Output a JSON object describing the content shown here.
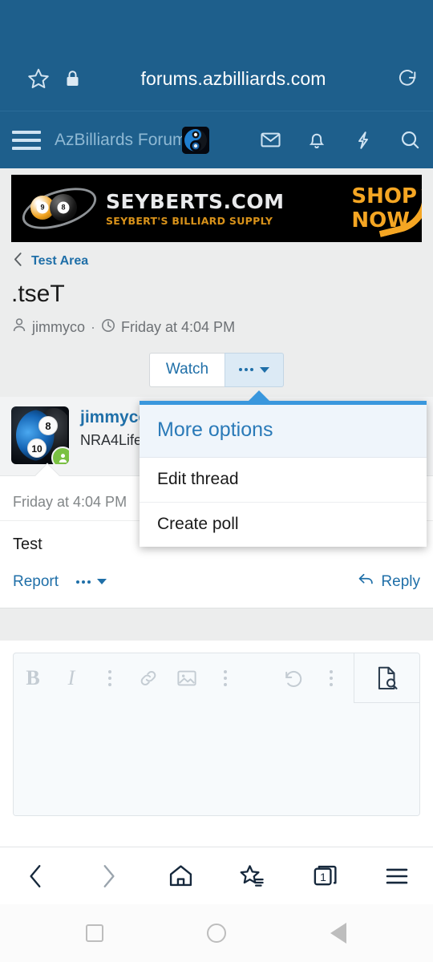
{
  "browser": {
    "url": "forums.azbilliards.com",
    "star_icon": "star-icon",
    "lock_icon": "lock-icon",
    "reload_icon": "reload-icon",
    "bottom_nav": {
      "back": "back-arrow-icon",
      "forward": "forward-arrow-icon",
      "home": "home-icon",
      "bookmarks": "bookmarks-star-icon",
      "tabs_count": "1",
      "menu": "hamburger-menu-icon"
    }
  },
  "system_nav": {
    "recents": "square-icon",
    "home": "circle-icon",
    "back": "triangle-back-icon"
  },
  "forum_header": {
    "menu_icon": "hamburger-menu-icon",
    "title": "AzBilliards Forum",
    "logo": "azbilliards-8ball-logo",
    "actions": [
      {
        "name": "inbox-icon",
        "label": "Inbox"
      },
      {
        "name": "alerts-bell-icon",
        "label": "Alerts"
      },
      {
        "name": "whats-new-bolt-icon",
        "label": "What's new"
      },
      {
        "name": "search-icon",
        "label": "Search"
      }
    ]
  },
  "ad": {
    "title": "SEYBERTS.COM",
    "subtitle": "SEYBERT'S BILLIARD SUPPLY",
    "cta_line1": "SHOP",
    "cta_line2": "NOW",
    "ball_nine": "9",
    "ball_eight": "8"
  },
  "breadcrumb": {
    "back_icon": "chevron-left-icon",
    "label": "Test Area"
  },
  "thread": {
    "title": ".tseT",
    "author": "jimmyco",
    "separator": "·",
    "timestamp": "Friday at 4:04 PM",
    "user_icon": "user-icon",
    "clock_icon": "clock-icon"
  },
  "thread_actions": {
    "watch_label": "Watch",
    "more_icon": "ellipsis-icon",
    "caret_icon": "chevron-down-icon"
  },
  "dropdown": {
    "header": "More options",
    "items": [
      {
        "label": "Edit thread"
      },
      {
        "label": "Create poll"
      }
    ]
  },
  "post": {
    "author": "jimmyco",
    "author_title": "NRA4Life",
    "avatar_ball_8": "8",
    "avatar_ball_10": "10",
    "online_icon": "online-status-icon",
    "date": "Friday at 4:04 PM",
    "body": "Test",
    "report_label": "Report",
    "more_icon": "ellipsis-icon",
    "caret_icon": "chevron-down-icon",
    "reply_label": "Reply",
    "reply_icon": "reply-arrow-icon"
  },
  "editor": {
    "bold_label": "B",
    "italic_label": "I",
    "toolbar": [
      {
        "name": "bold-button",
        "label": "B"
      },
      {
        "name": "italic-button",
        "label": "I"
      },
      {
        "name": "text-overflow-menu",
        "label": ""
      },
      {
        "name": "link-button",
        "label": ""
      },
      {
        "name": "image-button",
        "label": ""
      },
      {
        "name": "insert-overflow-menu",
        "label": ""
      },
      {
        "name": "undo-button",
        "label": ""
      },
      {
        "name": "history-overflow-menu",
        "label": ""
      }
    ],
    "preview_icon": "preview-document-icon",
    "textarea_value": "",
    "textarea_placeholder": ""
  },
  "colors": {
    "chrome_blue": "#1e5f8c",
    "accent_link": "#1f6fa8",
    "menu_top_border": "#3a97dd",
    "menu_header_bg": "#eff5fb",
    "online_green": "#7ac142",
    "ad_gold": "#f5a623"
  }
}
